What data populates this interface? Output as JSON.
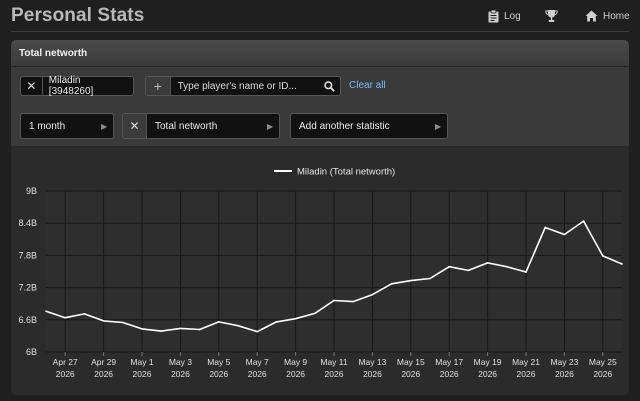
{
  "header": {
    "title": "Personal Stats",
    "log_label": "Log",
    "home_label": "Home",
    "icons": [
      "clipboard-icon",
      "trophy-icon",
      "home-icon"
    ]
  },
  "panel": {
    "title": "Total networth"
  },
  "player_filter": {
    "selected_player": "Miladin [3948260]",
    "search_placeholder": "Type player's name or ID...",
    "clear_all_label": "Clear all"
  },
  "selectors": {
    "period": "1 month",
    "statistic": "Total networth",
    "add_statistic": "Add another statistic"
  },
  "colors": {
    "accent_link": "#76b9ff",
    "line": "#ffffff",
    "background": "#1f1f1f",
    "panel": "#2b2b2b"
  },
  "chart_data": {
    "type": "line",
    "legend": "Miladin (Total networth)",
    "legend_position": "top-center",
    "ylim": [
      6,
      9
    ],
    "y_ticks": [
      "6B",
      "6.6B",
      "7.2B",
      "7.8B",
      "8.4B",
      "9B"
    ],
    "y_tick_values": [
      6,
      6.6,
      7.2,
      7.8,
      8.4,
      9
    ],
    "x_ticks": [
      {
        "label": [
          "Apr 27",
          "2026"
        ],
        "date": "2026-04-27"
      },
      {
        "label": [
          "Apr 29",
          "2026"
        ],
        "date": "2026-04-29"
      },
      {
        "label": [
          "May 1",
          "2026"
        ],
        "date": "2026-05-01"
      },
      {
        "label": [
          "May 3",
          "2026"
        ],
        "date": "2026-05-03"
      },
      {
        "label": [
          "May 5",
          "2026"
        ],
        "date": "2026-05-05"
      },
      {
        "label": [
          "May 7",
          "2026"
        ],
        "date": "2026-05-07"
      },
      {
        "label": [
          "May 9",
          "2026"
        ],
        "date": "2026-05-09"
      },
      {
        "label": [
          "May 11",
          "2026"
        ],
        "date": "2026-05-11"
      },
      {
        "label": [
          "May 13",
          "2026"
        ],
        "date": "2026-05-13"
      },
      {
        "label": [
          "May 15",
          "2026"
        ],
        "date": "2026-05-15"
      },
      {
        "label": [
          "May 17",
          "2026"
        ],
        "date": "2026-05-17"
      },
      {
        "label": [
          "May 19",
          "2026"
        ],
        "date": "2026-05-19"
      },
      {
        "label": [
          "May 21",
          "2026"
        ],
        "date": "2026-05-21"
      },
      {
        "label": [
          "May 23",
          "2026"
        ],
        "date": "2026-05-23"
      },
      {
        "label": [
          "May 25",
          "2026"
        ],
        "date": "2026-05-25"
      }
    ],
    "grid": true,
    "series": [
      {
        "name": "Miladin (Total networth)",
        "x": [
          "2026-04-26",
          "2026-04-27",
          "2026-04-28",
          "2026-04-29",
          "2026-04-30",
          "2026-05-01",
          "2026-05-02",
          "2026-05-03",
          "2026-05-04",
          "2026-05-05",
          "2026-05-06",
          "2026-05-07",
          "2026-05-08",
          "2026-05-09",
          "2026-05-10",
          "2026-05-11",
          "2026-05-12",
          "2026-05-13",
          "2026-05-14",
          "2026-05-15",
          "2026-05-16",
          "2026-05-17",
          "2026-05-18",
          "2026-05-19",
          "2026-05-20",
          "2026-05-21",
          "2026-05-22",
          "2026-05-23",
          "2026-05-24",
          "2026-05-25",
          "2026-05-26"
        ],
        "values": [
          6.76,
          6.64,
          6.71,
          6.58,
          6.55,
          6.43,
          6.39,
          6.44,
          6.42,
          6.56,
          6.49,
          6.38,
          6.56,
          6.62,
          6.72,
          6.96,
          6.94,
          7.07,
          7.27,
          7.33,
          7.37,
          7.59,
          7.52,
          7.66,
          7.59,
          7.49,
          8.32,
          8.19,
          8.44,
          7.79,
          7.64
        ]
      }
    ]
  }
}
